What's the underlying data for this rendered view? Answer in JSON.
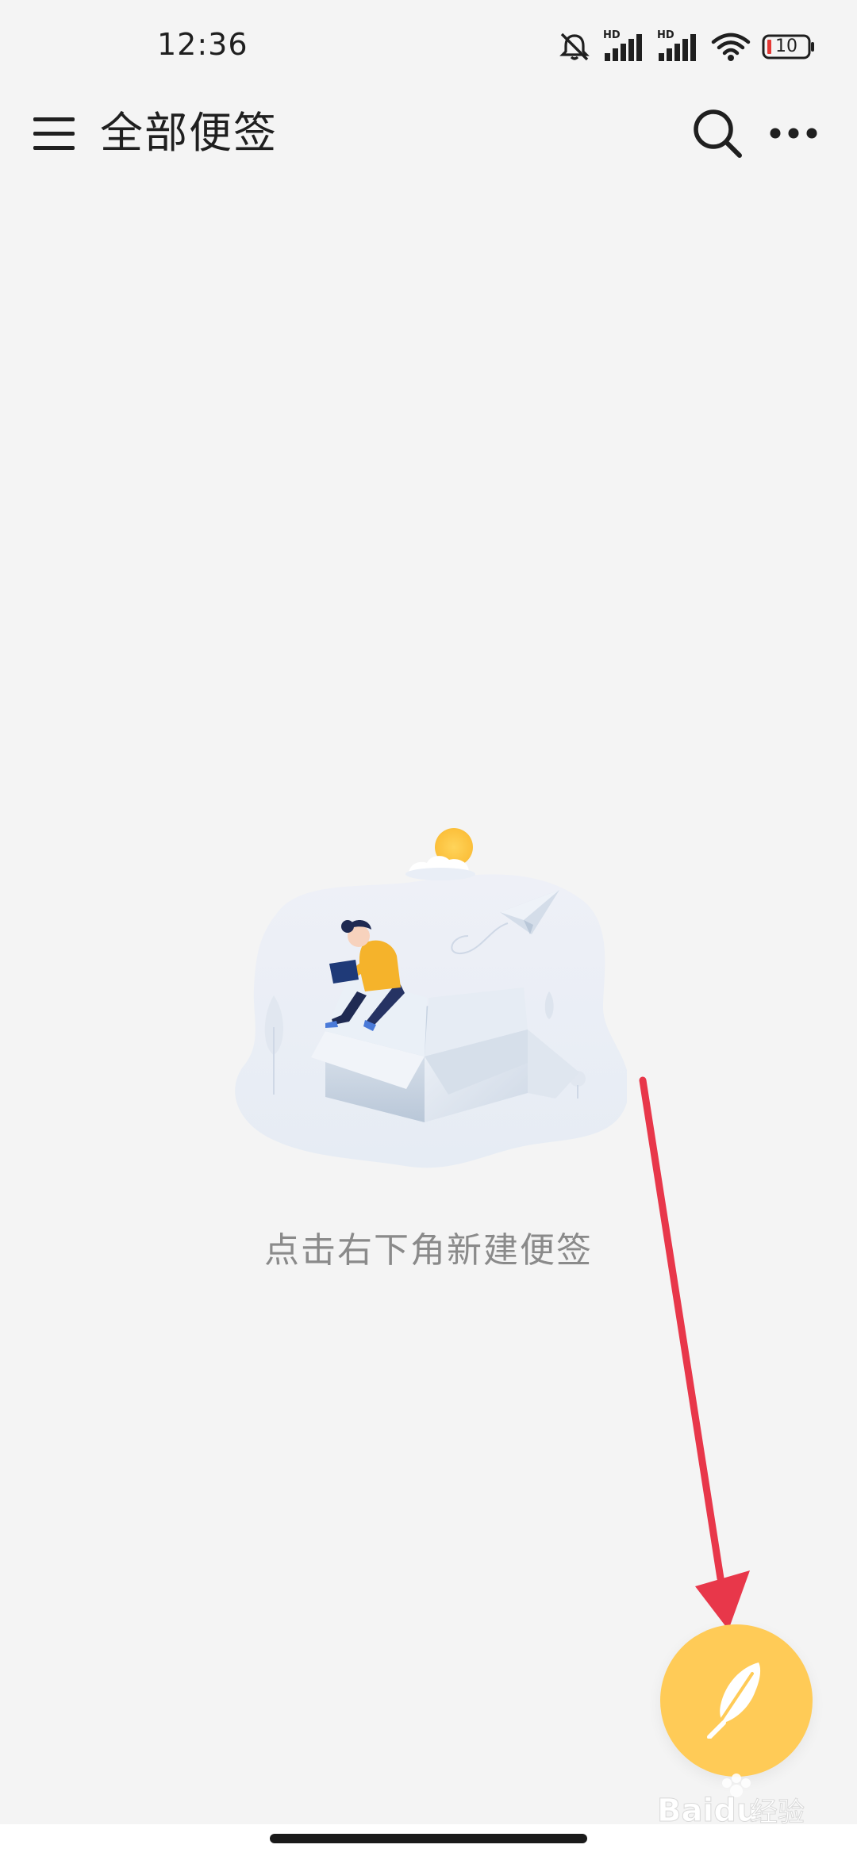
{
  "status_bar": {
    "time": "12:36",
    "battery_level": "10",
    "icons": [
      "mute-icon",
      "hd-signal-icon",
      "hd-signal-icon",
      "wifi-icon",
      "battery-icon"
    ],
    "hd_label": "HD"
  },
  "app_bar": {
    "title": "全部便签",
    "icons": [
      "menu-icon",
      "search-icon",
      "more-icon"
    ]
  },
  "empty_state": {
    "hint": "点击右下角新建便签",
    "illustration": "person-sitting-on-box-illustration"
  },
  "fab": {
    "icon": "feather-icon",
    "color": "#ffcb57"
  },
  "annotation": {
    "arrow_color": "#e8374a"
  },
  "colors": {
    "background": "#f4f4f4",
    "accent": "#ffcb57",
    "hint_text": "#8a8a8a"
  }
}
